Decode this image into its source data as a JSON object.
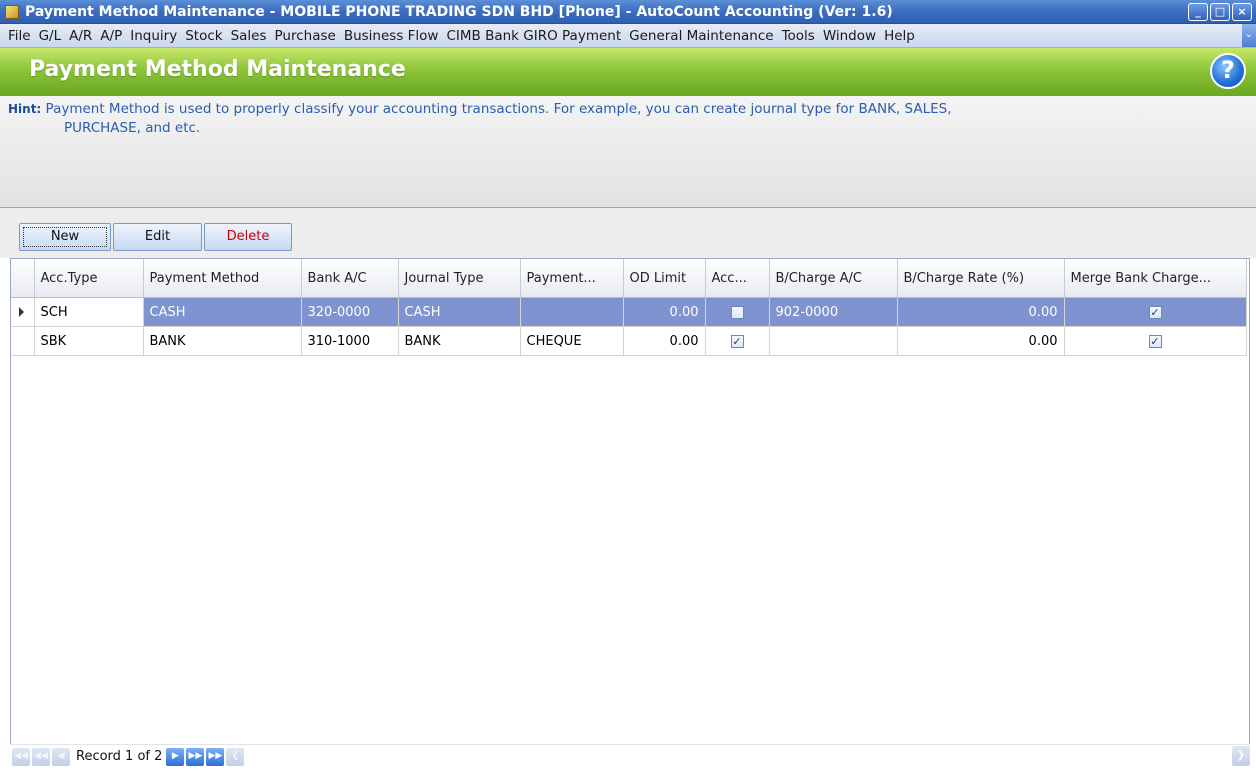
{
  "window": {
    "title": "Payment Method Maintenance - MOBILE PHONE TRADING SDN BHD [Phone] - AutoCount Accounting (Ver: 1.6)",
    "minimize": "_",
    "maximize": "□",
    "close": "×"
  },
  "menu": [
    "File",
    "G/L",
    "A/R",
    "A/P",
    "Inquiry",
    "Stock",
    "Sales",
    "Purchase",
    "Business Flow",
    "CIMB Bank GIRO Payment",
    "General Maintenance",
    "Tools",
    "Window",
    "Help"
  ],
  "header": {
    "title": "Payment Method Maintenance",
    "help": "?"
  },
  "hint": {
    "label": "Hint:",
    "line1": "Payment Method is used to properly classify your accounting transactions. For example, you can create journal type for BANK, SALES,",
    "line2": "PURCHASE, and etc."
  },
  "toolbar": {
    "new": "New",
    "edit": "Edit",
    "delete": "Delete"
  },
  "grid": {
    "columns": [
      "Acc.Type",
      "Payment Method",
      "Bank A/C",
      "Journal Type",
      "Payment...",
      "OD Limit",
      "Acc...",
      "B/Charge A/C",
      "B/Charge Rate (%)",
      "Merge Bank Charge..."
    ],
    "rows": [
      {
        "acc_type": "SCH",
        "payment_method": "CASH",
        "bank_ac": "320-0000",
        "journal_type": "CASH",
        "payment": "",
        "od_limit": "0.00",
        "acc_checked": false,
        "bcharge_ac": "902-0000",
        "bcharge_rate": "0.00",
        "merge_checked": true
      },
      {
        "acc_type": "SBK",
        "payment_method": "BANK",
        "bank_ac": "310-1000",
        "journal_type": "BANK",
        "payment": "CHEQUE",
        "od_limit": "0.00",
        "acc_checked": true,
        "bcharge_ac": "",
        "bcharge_rate": "0.00",
        "merge_checked": true
      }
    ]
  },
  "navigator": {
    "record_text": "Record 1 of 2"
  },
  "colors": {
    "header_green": "#8cc43a",
    "title_blue": "#3b6cc0",
    "selected_row": "#7e93cf",
    "hint_text": "#2a5db0",
    "delete_red": "#d00000"
  }
}
